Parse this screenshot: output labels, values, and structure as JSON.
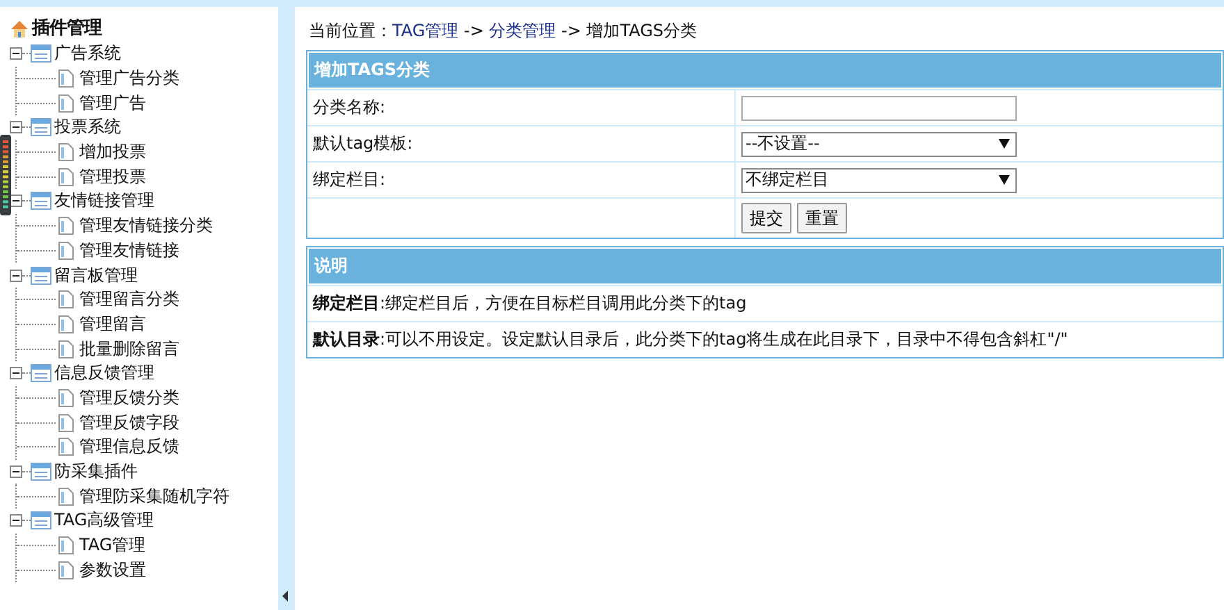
{
  "sidebar": {
    "title": "插件管理",
    "groups": [
      {
        "label": "广告系统",
        "expanded": true,
        "children": [
          {
            "label": "管理广告分类"
          },
          {
            "label": "管理广告"
          }
        ]
      },
      {
        "label": "投票系统",
        "expanded": true,
        "children": [
          {
            "label": "增加投票"
          },
          {
            "label": "管理投票"
          }
        ]
      },
      {
        "label": "友情链接管理",
        "expanded": true,
        "children": [
          {
            "label": "管理友情链接分类"
          },
          {
            "label": "管理友情链接"
          }
        ]
      },
      {
        "label": "留言板管理",
        "expanded": true,
        "children": [
          {
            "label": "管理留言分类"
          },
          {
            "label": "管理留言"
          },
          {
            "label": "批量删除留言"
          }
        ]
      },
      {
        "label": "信息反馈管理",
        "expanded": true,
        "children": [
          {
            "label": "管理反馈分类"
          },
          {
            "label": "管理反馈字段"
          },
          {
            "label": "管理信息反馈"
          }
        ]
      },
      {
        "label": "防采集插件",
        "expanded": true,
        "children": [
          {
            "label": "管理防采集随机字符"
          }
        ]
      },
      {
        "label": "TAG高级管理",
        "expanded": true,
        "children": [
          {
            "label": "TAG管理"
          },
          {
            "label": "参数设置"
          }
        ]
      }
    ]
  },
  "breadcrumb": [
    {
      "kind": "text",
      "text": "当前位置："
    },
    {
      "kind": "link",
      "text": "TAG管理"
    },
    {
      "kind": "text",
      "text": " -> "
    },
    {
      "kind": "link",
      "text": "分类管理"
    },
    {
      "kind": "text",
      "text": " -> 增加TAGS分类"
    }
  ],
  "form": {
    "title": "增加TAGS分类",
    "rows": [
      {
        "kind": "text",
        "label": "分类名称:"
      },
      {
        "kind": "select",
        "label": "默认tag模板:",
        "value": "--不设置--"
      },
      {
        "kind": "select",
        "label": "绑定栏目:",
        "value": "不绑定栏目"
      }
    ],
    "buttons": [
      "提交",
      "重置"
    ]
  },
  "notes": {
    "title": "说明",
    "items": [
      "**绑定栏目**:绑定栏目后，方便在目标栏目调用此分类下的tag",
      "**默认目录**:可以不用设定。设定默认目录后，此分类下的tag将生成在此目录下，目录中不得包含斜杠\"/\""
    ]
  }
}
